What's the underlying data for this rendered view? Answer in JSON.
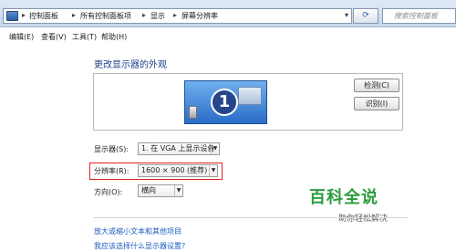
{
  "address_bar": {
    "breadcrumbs": [
      "控制面板",
      "所有控制面板项",
      "显示",
      "屏幕分辨率"
    ],
    "search_placeholder": "搜索控制面板"
  },
  "menu": [
    "编辑(E)",
    "查看(V)",
    "工具(T)",
    "帮助(H)"
  ],
  "page_title": "更改显示器的外观",
  "preview": {
    "monitor_number": "1",
    "detect_button": "检测(C)",
    "identify_button": "识别(I)"
  },
  "form": {
    "display_label": "显示器(S):",
    "display_value": "1. 在 VGA 上显示设备",
    "resolution_label": "分辨率(R):",
    "resolution_value": "1600 × 900 (推荐)",
    "orientation_label": "方向(O):",
    "orientation_value": "横向"
  },
  "links": {
    "text_size": "放大或缩小文本和其他项目",
    "which_settings": "我应该选择什么显示器设置?"
  },
  "watermark": {
    "title": "百科全说",
    "subtitle": "助你轻松解决"
  },
  "colors": {
    "highlight": "#e02323",
    "link": "#1c5dbf",
    "heading": "#1e3f8a",
    "watermark": "#2b9c3c"
  }
}
